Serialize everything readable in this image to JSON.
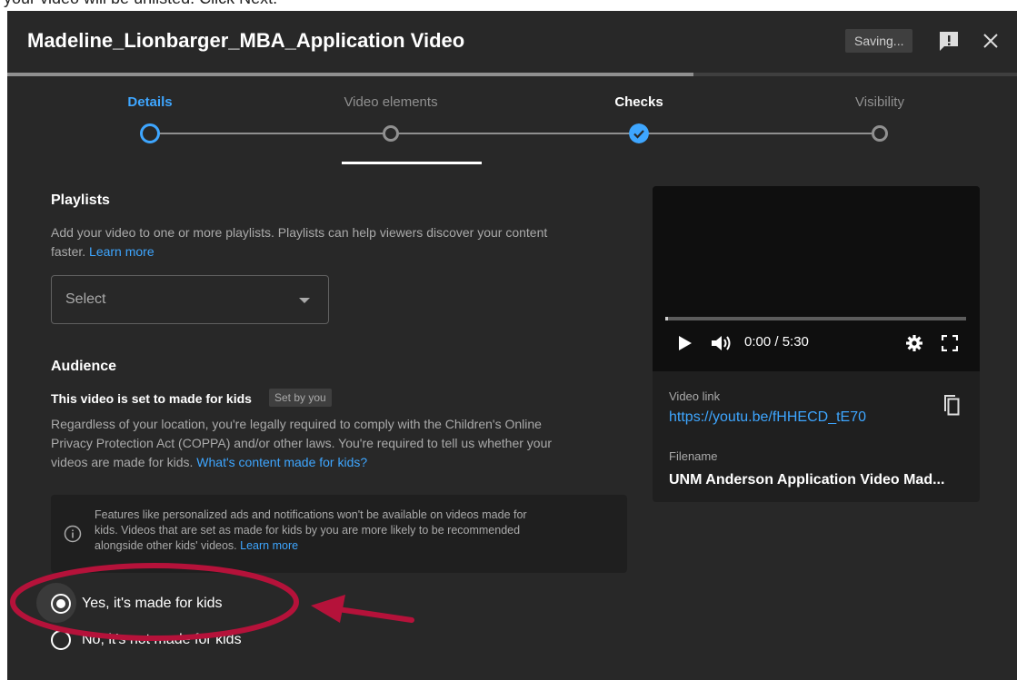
{
  "caption": "your video will be unlisted. Click Next.",
  "header": {
    "title": "Madeline_Lionbarger_MBA_Application Video",
    "status": "Saving...",
    "upload_progress_percent": 68
  },
  "steps": [
    {
      "label": "Details",
      "state": "active"
    },
    {
      "label": "Video elements",
      "state": "pending"
    },
    {
      "label": "Checks",
      "state": "done"
    },
    {
      "label": "Visibility",
      "state": "pending"
    }
  ],
  "playlists": {
    "title": "Playlists",
    "description": "Add your video to one or more playlists. Playlists can help viewers discover your content",
    "description2": "faster.",
    "learn_more": "Learn more",
    "select_value": "Select"
  },
  "audience": {
    "title": "Audience",
    "status_text": "This video is set to made for kids",
    "badge": "Set by you",
    "body_line1": "Regardless of your location, you're legally required to comply with the Children's Online",
    "body_line2": "Privacy Protection Act (COPPA) and/or other laws. You're required to tell us whether your",
    "body_line3": "videos are made for kids.",
    "body_link": "What's content made for kids?",
    "info_line1": "Features like personalized ads and notifications won't be available on videos made for",
    "info_line2": "kids. Videos that are set as made for kids by you are more likely to be recommended",
    "info_line3": "alongside other kids' videos.",
    "info_link": "Learn more",
    "option_yes": "Yes, it's made for kids",
    "option_no": "No, it's not made for kids",
    "selected": "yes"
  },
  "video": {
    "time": "0:00 / 5:30",
    "link_label": "Video link",
    "link": "https://youtu.be/fHHECD_tE70",
    "filename_label": "Filename",
    "filename": "UNM Anderson Application Video Mad..."
  },
  "colors": {
    "background": "#282828",
    "accent": "#3ea6ff",
    "annotation": "#b5123a"
  }
}
